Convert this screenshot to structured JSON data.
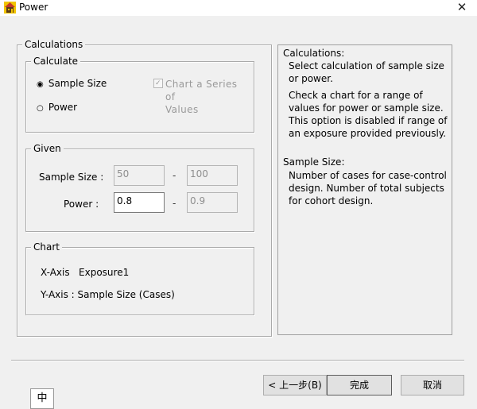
{
  "window": {
    "title": "Power"
  },
  "calculations_group": {
    "legend": "Calculations",
    "calculate": {
      "legend": "Calculate",
      "options": [
        "Sample Size",
        "Power"
      ],
      "selected": "Sample Size",
      "series_checkbox": {
        "line1": "Chart a Series of",
        "line2": "Values",
        "checked": true,
        "disabled": true
      }
    },
    "given": {
      "legend": "Given",
      "sample_size_label": "Sample Size :",
      "sample_size_from": "50",
      "sample_size_to": "100",
      "power_label": "Power :",
      "power_from": "0.8",
      "power_to": "0.9",
      "dash": "-"
    },
    "chart": {
      "legend": "Chart",
      "x_axis": "X-Axis   Exposure1",
      "y_axis": "Y-Axis : Sample Size (Cases)"
    }
  },
  "help": {
    "heading1": "Calculations:",
    "para1": "Select calculation of sample size or power.",
    "para2": "Check a chart for a range of values for power or sample size.  This option is disabled if range of an exposure provided previously.",
    "heading2": "Sample Size:",
    "para3": "Number of cases for case-control design.  Number of total subjects for cohort design."
  },
  "buttons": {
    "back": "< 上一步(B)",
    "finish": "完成",
    "cancel": "取消"
  },
  "ime": {
    "label": "中"
  },
  "colors": {
    "window_bg": "#f0f0f0",
    "desktop": "#5a7f95"
  }
}
